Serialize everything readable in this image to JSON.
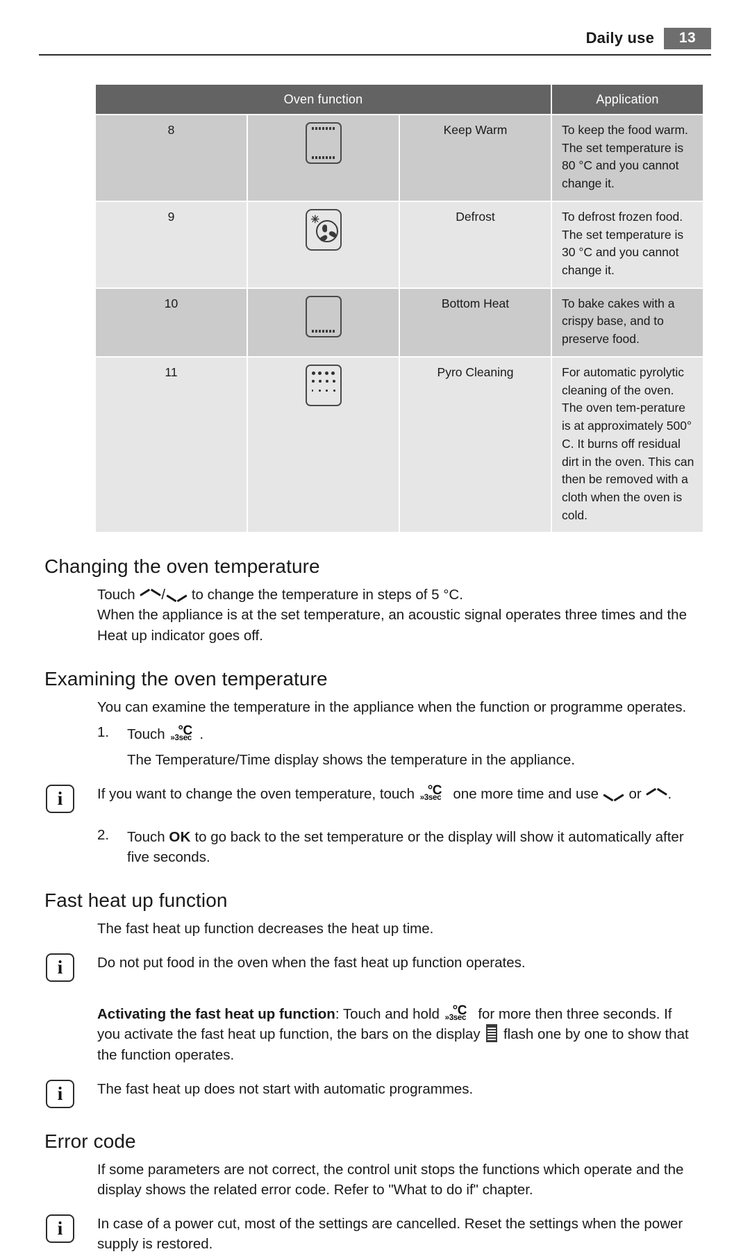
{
  "header": {
    "chapter_title": "Daily use",
    "page_number": "13"
  },
  "function_table": {
    "columns": [
      "Oven function",
      "Application"
    ],
    "rows": [
      {
        "number": "8",
        "icon": "oven-keep-warm-icon",
        "name": "Keep Warm",
        "application": [
          "To keep the food warm.",
          "The set temperature is 80 °C and you cannot change it."
        ]
      },
      {
        "number": "9",
        "icon": "oven-defrost-icon",
        "name": "Defrost",
        "application": [
          "To defrost frozen food.",
          "The set temperature is 30 °C and you cannot change it."
        ]
      },
      {
        "number": "10",
        "icon": "oven-bottom-heat-icon",
        "name": "Bottom Heat",
        "application": [
          "To bake cakes with a crispy base, and to preserve food."
        ]
      },
      {
        "number": "11",
        "icon": "oven-pyro-cleaning-icon",
        "name": "Pyro Cleaning",
        "application": [
          "For automatic pyrolytic cleaning of the oven. The oven tem-perature is at approximately 500° C. It burns off residual dirt in the oven. This can then be removed with a cloth when the oven is cold."
        ]
      }
    ]
  },
  "sections": {
    "changing": {
      "heading": "Changing the oven temperature",
      "touch_label": "Touch",
      "separator": "/",
      "after_arrows": "to change the temperature in steps of 5 °C.",
      "paragraph": "When the appliance is at the set temperature, an acoustic signal operates three times and the Heat up indicator goes off."
    },
    "examining": {
      "heading": "Examining the oven temperature",
      "intro": "You can examine the temperature in the appliance when the function or programme operates.",
      "step1_number": "1.",
      "step1_touch": "Touch",
      "step1_after": ".",
      "step1_result": "The Temperature/Time display shows the temperature in the appliance.",
      "note_before": "If you want to change the oven temperature, touch",
      "note_middle": "one more time and use",
      "note_or": "or",
      "note_end": ".",
      "step2_number": "2.",
      "step2_before_ok": "Touch",
      "step2_ok": "OK",
      "step2_after_ok": "to go back to the set temperature or the display will show it automatically after five seconds."
    },
    "fast_heat": {
      "heading": "Fast heat up function",
      "intro": "The fast heat up function decreases the heat up time.",
      "note1": "Do not put food in the oven when the fast heat up function operates.",
      "activating_bold": "Activating the fast heat up function",
      "activating_before": ": Touch and hold",
      "activating_after": "for more then three seconds.",
      "bars_before": "If you activate the fast heat up function, the bars on the display",
      "bars_after": "flash one by one to show that the function operates.",
      "note2": "The fast heat up does not start with automatic programmes."
    },
    "error_code": {
      "heading": "Error code",
      "paragraph": "If some parameters are not correct, the control unit stops the functions which operate and the display shows the related error code. Refer to \"What to do if\" chapter.",
      "note": "In case of a power cut, most of the settings are cancelled. Reset the settings when the power supply is restored."
    }
  },
  "glyphs": {
    "degc_c": "°C",
    "degc_sec": "»3sec",
    "info_letter": "i",
    "snow_star": "✳"
  },
  "colors": {
    "table_header_bg": "#636363",
    "row_dark_bg": "#cbcbcb",
    "row_light_bg": "#e6e6e6",
    "page_badge_bg": "#6e6e6e",
    "text": "#1a1a1a"
  }
}
